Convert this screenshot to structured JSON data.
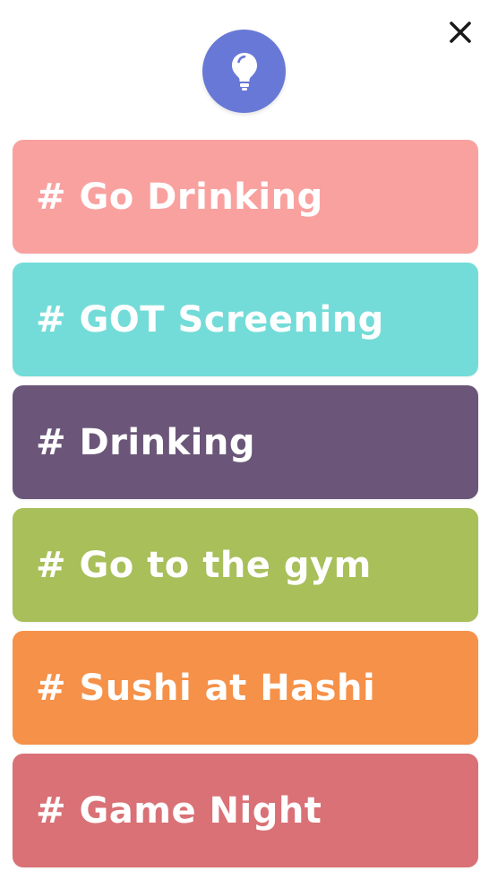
{
  "header": {
    "close_icon": "close-icon",
    "bulb_icon": "lightbulb-icon",
    "bulb_color": "#6878d6"
  },
  "topics": [
    {
      "label": "# Go Drinking",
      "color": "#f9a19f"
    },
    {
      "label": "# GOT Screening",
      "color": "#74dcd8"
    },
    {
      "label": "# Drinking",
      "color": "#6b5679"
    },
    {
      "label": "# Go to the gym",
      "color": "#a8bf5a"
    },
    {
      "label": "# Sushi at Hashi",
      "color": "#f59149"
    },
    {
      "label": "# Game Night",
      "color": "#d97176"
    }
  ]
}
